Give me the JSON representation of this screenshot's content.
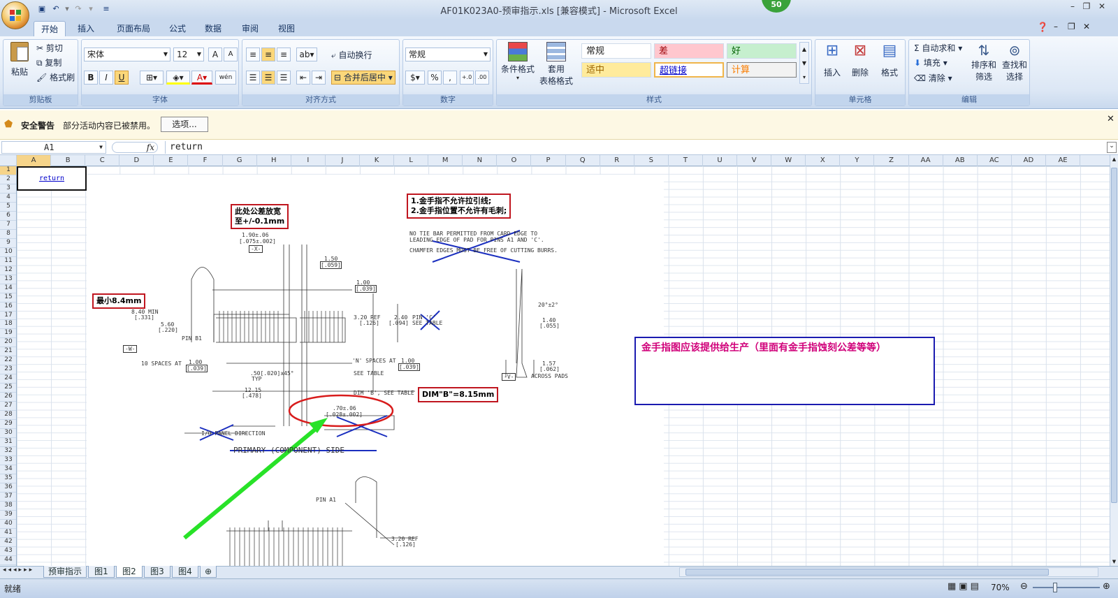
{
  "window": {
    "title": "AF01K023A0-预审指示.xls  [兼容模式] - Microsoft Excel",
    "badge": "50"
  },
  "ribbon_tabs": [
    "开始",
    "插入",
    "页面布局",
    "公式",
    "数据",
    "审阅",
    "视图"
  ],
  "groups": {
    "clipboard": {
      "label": "剪贴板",
      "paste": "粘贴",
      "cut": "剪切",
      "copy": "复制",
      "format_painter": "格式刷"
    },
    "font": {
      "label": "字体",
      "font_name": "宋体",
      "font_size": "12",
      "bold": "B",
      "italic": "I",
      "underline": "U",
      "wen": "wén"
    },
    "alignment": {
      "label": "对齐方式",
      "wrap": "自动换行",
      "merge": "合并后居中"
    },
    "number": {
      "label": "数字",
      "format": "常规",
      "percent": "%",
      "comma": ","
    },
    "styles": {
      "label": "样式",
      "conditional": "条件格式",
      "table_style_1": "套用",
      "table_style_2": "表格格式",
      "normal": "常规",
      "bad": "差",
      "good": "好",
      "neutral": "适中",
      "hyperlink": "超链接",
      "calc": "计算"
    },
    "cells": {
      "label": "单元格",
      "insert": "插入",
      "delete": "删除",
      "format": "格式"
    },
    "editing": {
      "label": "编辑",
      "autosum": "自动求和",
      "fill": "填充",
      "clear": "清除",
      "sort_1": "排序和",
      "sort_2": "筛选",
      "find_1": "查找和",
      "find_2": "选择"
    }
  },
  "security": {
    "title": "安全警告",
    "message": "部分活动内容已被禁用。",
    "options": "选项..."
  },
  "formula_bar": {
    "name_box": "A1",
    "fx": "fx",
    "content": "return"
  },
  "columns": [
    "A",
    "B",
    "C",
    "D",
    "E",
    "F",
    "G",
    "H",
    "I",
    "J",
    "K",
    "L",
    "M",
    "N",
    "O",
    "P",
    "Q",
    "R",
    "S",
    "T",
    "U",
    "V",
    "W",
    "X",
    "Y",
    "Z",
    "AA",
    "AB",
    "AC",
    "AD",
    "AE"
  ],
  "rows": [
    "1",
    "2",
    "3",
    "4",
    "5",
    "6",
    "7",
    "8",
    "9",
    "10",
    "11",
    "12",
    "13",
    "14",
    "15",
    "16",
    "17",
    "18",
    "19",
    "20",
    "21",
    "22",
    "23",
    "24",
    "25",
    "26",
    "27",
    "28",
    "29",
    "30",
    "31",
    "32",
    "33",
    "34",
    "35",
    "36",
    "37",
    "38",
    "39",
    "40",
    "41",
    "42",
    "43",
    "44"
  ],
  "cell_link": "return",
  "drawing": {
    "note_tolerance": "此处公差放宽\n至+/-0.1mm",
    "note_gold": "1.金手指不允许拉引线;\n2.金手指位置不允许有毛刺;",
    "note_min": "最小8.4mm",
    "note_dimb": "DIM\"B\"=8.15mm",
    "dims": {
      "d1": "1.90±.06",
      "d1b": "[.075±.002]",
      "dx": "-X-",
      "d2": "1.50",
      "d2b": "[.059]",
      "d3": "1.00",
      "d3b": "[.039]",
      "d4": "3.20 REF",
      "d4b": "[.126]",
      "d5": "2.40",
      "d5b": "[.094]",
      "pin_c": "PIN 'C'",
      "see_table": "SEE TABLE",
      "d6": "8.40 MIN",
      "d6b": "[.331]",
      "d7": "5.60",
      "d7b": "[.220]",
      "pin_b1": "PIN B1",
      "dw": "-W-",
      "spaces": "10 SPACES AT",
      "d8": "1.00",
      "d8b": "[.039]",
      "d9": ".50[.020]x45°",
      "typ": "TYP",
      "d10": "12.15",
      "d10b": "[.478]",
      "nspaces": "'N' SPACES AT",
      "d11": "1.00",
      "d11b": "[.039]",
      "see_table2": "SEE TABLE",
      "dimb": "DIM 'B', SEE TABLE",
      "d12": ".70±.06",
      "d12b": "[.028±.002]",
      "io": "I/O PANEL DIRECTION",
      "primary": "PRIMARY (COMPONENT) SIDE",
      "note1": "NO TIE BAR PERMITTED FROM CARD EDGE TO",
      "note1b": "LEADING EDGE OF PAD FOR PINS A1 AND 'C'.",
      "note2": "CHAMFER EDGES MUST BE FREE OF CUTTING BURRS.",
      "angle": "20°±2°",
      "d13": "1.40",
      "d13b": "[.055]",
      "d14": "1.57",
      "d14b": "[.062]",
      "across": "ACROSS PADS",
      "dv": "-V-",
      "pin_a1": "PIN A1",
      "d15": "3.20 REF",
      "d15b": "[.126]"
    }
  },
  "comment_box": "金手指图应该提供给生产（里面有金手指蚀刻公差等等）",
  "sheet_tabs": [
    "预审指示",
    "图1",
    "图2",
    "图3",
    "图4"
  ],
  "status": {
    "ready": "就绪",
    "zoom": "70%"
  }
}
